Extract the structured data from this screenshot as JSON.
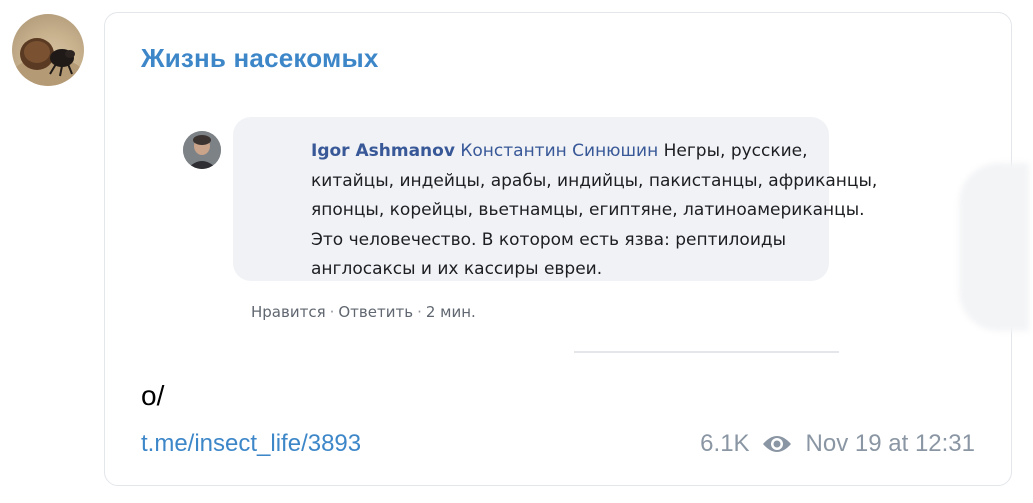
{
  "channel": {
    "name": "Жизнь насекомых"
  },
  "comment": {
    "author": "Igor Ashmanov",
    "mention": "Константин Синюшин",
    "text": "Негры, русские, китайцы, индейцы, арабы, индийцы, пакистанцы, африканцы, японцы, корейцы, вьетнамцы, египтяне, латиноамериканцы. Это человечество. В котором есть язва: рептилоиды англосаксы и их кассиры евреи.",
    "like_label": "Нравится",
    "reply_label": "Ответить",
    "time": "2 мин.",
    "separator": "·"
  },
  "post": {
    "text": "o/",
    "link": "t.me/insect_life/3893",
    "views": "6.1K",
    "date": "Nov 19 at 12:31"
  },
  "icons": {
    "views": "eye-icon"
  },
  "colors": {
    "accent": "#3d87c9",
    "meta": "#8a96a3",
    "fb_link": "#385898",
    "bubble_bg": "#f0f2f5"
  }
}
